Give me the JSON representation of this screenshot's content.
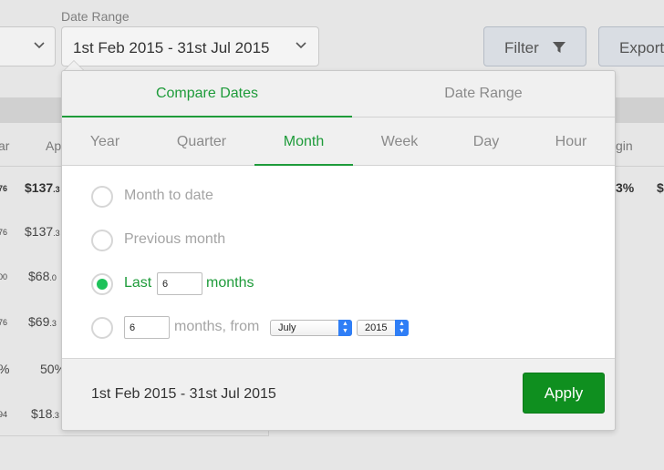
{
  "filters": {
    "date_range_label": "Date Range",
    "date_range_value": "1st Feb 2015 - 31st Jul 2015",
    "filter_label": "Filter",
    "export_label": "Export"
  },
  "background_table": {
    "headers": [
      "ar",
      "Ap",
      "gin"
    ],
    "rows": [
      {
        "a": "76",
        "b": "$137",
        "b_small": ".3",
        "c": "3%",
        "d": "$"
      },
      {
        "a": "76",
        "b": "$137",
        "b_small": ".3"
      },
      {
        "a": "00",
        "b": "$68",
        "b_small": ".0"
      },
      {
        "a": "76",
        "b": "$69",
        "b_small": ".3"
      },
      {
        "a": "%",
        "b": "50%"
      },
      {
        "a": "94",
        "b": "$18",
        "b_small": ".3"
      }
    ]
  },
  "popover": {
    "tabs": [
      {
        "label": "Compare Dates",
        "active": true
      },
      {
        "label": "Date Range",
        "active": false
      }
    ],
    "periods": [
      {
        "label": "Year"
      },
      {
        "label": "Quarter"
      },
      {
        "label": "Month",
        "active": true
      },
      {
        "label": "Week"
      },
      {
        "label": "Day"
      },
      {
        "label": "Hour"
      }
    ],
    "options": {
      "month_to_date": "Month to date",
      "previous_month": "Previous month",
      "last_prefix": "Last",
      "last_value": "6",
      "last_suffix": "months",
      "from_value": "6",
      "from_label": "months, from",
      "from_month": "July",
      "from_year": "2015"
    },
    "selected_option": "last",
    "footer_range": "1st Feb 2015 - 31st Jul 2015",
    "apply_label": "Apply"
  },
  "colors": {
    "accent_green": "#1e9b3a",
    "apply_green": "#0f8f1f",
    "select_blue": "#2f7ef6"
  }
}
